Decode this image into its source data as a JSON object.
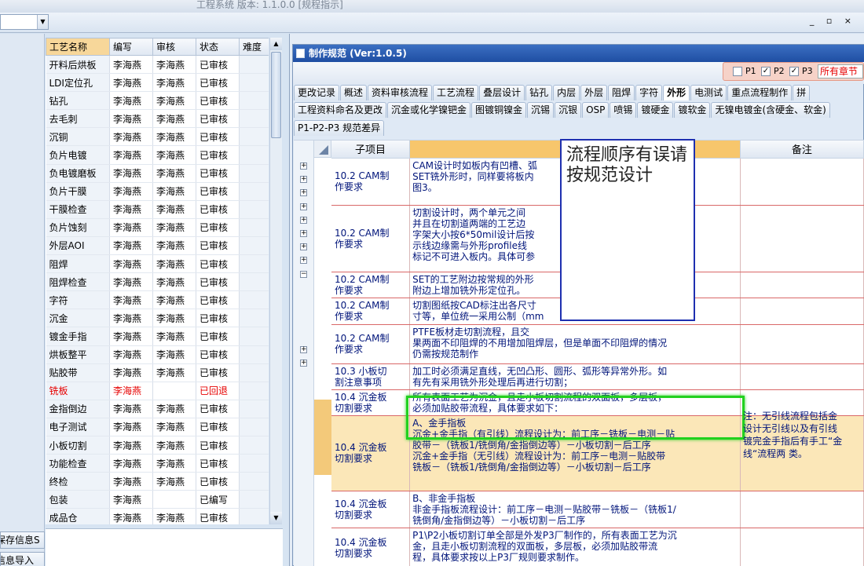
{
  "window": {
    "title": "工程系统 版本: 1.1.0.0 [规程指示]",
    "controls": "_ ▫ ×"
  },
  "left": {
    "columns": [
      "工艺名称",
      "编写",
      "审核",
      "状态",
      "难度"
    ],
    "rows": [
      {
        "name": "开料后烘板",
        "author": "李海燕",
        "reviewer": "李海燕",
        "status": "已审核"
      },
      {
        "name": "LDI定位孔",
        "author": "李海燕",
        "reviewer": "李海燕",
        "status": "已审核"
      },
      {
        "name": "钻孔",
        "author": "李海燕",
        "reviewer": "李海燕",
        "status": "已审核"
      },
      {
        "name": "去毛刺",
        "author": "李海燕",
        "reviewer": "李海燕",
        "status": "已审核"
      },
      {
        "name": "沉铜",
        "author": "李海燕",
        "reviewer": "李海燕",
        "status": "已审核"
      },
      {
        "name": "负片电镀",
        "author": "李海燕",
        "reviewer": "李海燕",
        "status": "已审核"
      },
      {
        "name": "负电镀磨板",
        "author": "李海燕",
        "reviewer": "李海燕",
        "status": "已审核"
      },
      {
        "name": "负片干膜",
        "author": "李海燕",
        "reviewer": "李海燕",
        "status": "已审核"
      },
      {
        "name": "干膜检查",
        "author": "李海燕",
        "reviewer": "李海燕",
        "status": "已审核"
      },
      {
        "name": "负片蚀刻",
        "author": "李海燕",
        "reviewer": "李海燕",
        "status": "已审核"
      },
      {
        "name": "外层AOI",
        "author": "李海燕",
        "reviewer": "李海燕",
        "status": "已审核"
      },
      {
        "name": "阻焊",
        "author": "李海燕",
        "reviewer": "李海燕",
        "status": "已审核"
      },
      {
        "name": "阻焊检查",
        "author": "李海燕",
        "reviewer": "李海燕",
        "status": "已审核"
      },
      {
        "name": "字符",
        "author": "李海燕",
        "reviewer": "李海燕",
        "status": "已审核"
      },
      {
        "name": "沉金",
        "author": "李海燕",
        "reviewer": "李海燕",
        "status": "已审核"
      },
      {
        "name": "镀金手指",
        "author": "李海燕",
        "reviewer": "李海燕",
        "status": "已审核"
      },
      {
        "name": "烘板整平",
        "author": "李海燕",
        "reviewer": "李海燕",
        "status": "已审核"
      },
      {
        "name": "贴胶带",
        "author": "李海燕",
        "reviewer": "李海燕",
        "status": "已审核"
      },
      {
        "name": "铣板",
        "author": "李海燕",
        "reviewer": "",
        "status": "已回退",
        "red": true
      },
      {
        "name": "金指倒边",
        "author": "李海燕",
        "reviewer": "李海燕",
        "status": "已审核"
      },
      {
        "name": "电子测试",
        "author": "李海燕",
        "reviewer": "李海燕",
        "status": "已审核"
      },
      {
        "name": "小板切割",
        "author": "李海燕",
        "reviewer": "李海燕",
        "status": "已审核"
      },
      {
        "name": "功能检查",
        "author": "李海燕",
        "reviewer": "李海燕",
        "status": "已审核"
      },
      {
        "name": "终检",
        "author": "李海燕",
        "reviewer": "李海燕",
        "status": "已审核"
      },
      {
        "name": "包装",
        "author": "李海燕",
        "reviewer": "",
        "status": "已编写"
      },
      {
        "name": "成品仓",
        "author": "李海燕",
        "reviewer": "李海燕",
        "status": "已审核"
      }
    ],
    "button1": "保存信息S",
    "button2": "信息导入"
  },
  "spec": {
    "title": "制作规范 (Ver:1.0.5)",
    "filter": {
      "p1": "P1",
      "p2": "P2",
      "p3": "P3",
      "p1_checked": false,
      "p2_checked": true,
      "p3_checked": true,
      "section": "所有章节"
    },
    "tabs_row1": [
      "更改记录",
      "概述",
      "资料审核流程",
      "工艺流程",
      "叠层设计",
      "钻孔",
      "内层",
      "外层",
      "阻焊",
      "字符",
      "外形",
      "电测试",
      "重点流程制作",
      "拼"
    ],
    "active_tab": "外形",
    "tabs_row2": [
      "工程资料命名及更改",
      "沉金或化学镍钯金",
      "图镀铜镍金",
      "沉锡",
      "沉银",
      "OSP",
      "喷锡",
      "镀硬金",
      "镀软金",
      "无镍电镀金(含硬金、软金)"
    ],
    "tabs_row3": [
      "P1-P2-P3 规范差异"
    ],
    "columns": [
      "子项目",
      "",
      "备注"
    ],
    "rows": [
      {
        "sub": [
          "10.2 CAM制",
          "作要求"
        ],
        "lines": [
          "CAM设计时如板内有凹槽、弧",
          "SET铣外形时，同样要将板内",
          "图3。"
        ],
        "remark": ""
      },
      {
        "sub": [
          "10.2 CAM制",
          "作要求"
        ],
        "lines": [
          "切割设计时，两个单元之间",
          "并且在切割道两端的工艺边",
          "字架大小按6*50mil设计后按",
          "示线边缘需与外形profile线",
          "标记不可进入板内。具体可参"
        ],
        "remark": ""
      },
      {
        "sub": [
          "10.2 CAM制",
          "作要求"
        ],
        "lines": [
          "SET的工艺附边按常规的外形",
          "附边上增加铣外形定位孔。"
        ],
        "remark": ""
      },
      {
        "sub": [
          "10.2 CAM制",
          "作要求"
        ],
        "lines": [
          "切割图纸按CAD标注出各尺寸",
          "寸等，单位统一采用公制（mm"
        ],
        "remark": ""
      },
      {
        "sub": [
          "10.2 CAM制",
          "作要求"
        ],
        "lines": [
          "PTFE板材走切割流程，且交",
          "果两面不印阻焊的不用增加阻焊层，但是单面不印阻焊的情况",
          "仍需按规范制作"
        ],
        "remark": ""
      },
      {
        "sub": [
          "10.3 小板切",
          "割注意事项"
        ],
        "lines": [
          "加工时必须满足直线，无凹凸形、圆形、弧形等异常外形。如",
          "有先有采用铣外形处理后再进行切割；"
        ],
        "remark": ""
      },
      {
        "sub": [
          "10.4 沉金板",
          "切割要求"
        ],
        "lines": [
          "所有表面工艺为沉金，且走小板切割流程的双面板，多层板，",
          "必须加贴胶带流程，具体要求如下："
        ],
        "remark": ""
      },
      {
        "sub": [
          "10.4 沉金板",
          "切割要求"
        ],
        "lines": [
          "A、金手指板",
          "沉金+金手指（有引线）流程设计为：前工序－铣板－电测－贴",
          "胶带－（铣板1/铣倒角/金指倒边等）－小板切割－后工序",
          "沉金+金手指（无引线）流程设计为：前工序－电测－贴胶带",
          "铣板－（铣板1/铣倒角/金指倒边等）－小板切割－后工序"
        ],
        "remark": "",
        "highlight": true
      },
      {
        "sub": [
          "10.4 沉金板",
          "切割要求"
        ],
        "lines": [
          "B、非金手指板",
          "非金手指板流程设计：前工序－电测－贴胶带－铣板－（铣板1/",
          "铣倒角/金指倒边等）－小板切割－后工序"
        ],
        "remark": ""
      },
      {
        "sub": [
          "10.4 沉金板",
          "切割要求"
        ],
        "lines": [
          "P1\\P2小板切割订单全部是外发P3厂制作的，所有表面工艺为沉",
          "金，且走小板切割流程的双面板，多层板，必须加贴胶带流",
          "程，具体要求按以上P3厂规则要求制作。"
        ],
        "remark": ""
      }
    ],
    "highlight_remark": [
      "注：无引线流程包括金",
      "设计无引线以及有引线",
      "镀完金手指后有手工“金",
      "线“流程两 类。"
    ],
    "popup_text": "流程顺序有误请按规范设计"
  },
  "colors": {
    "selected_header": "#f7c66c",
    "highlight_row": "#fbe7b8",
    "annotation_border": "#22d11f",
    "popup_border": "#1e2fb0",
    "error_text": "#e60000"
  }
}
